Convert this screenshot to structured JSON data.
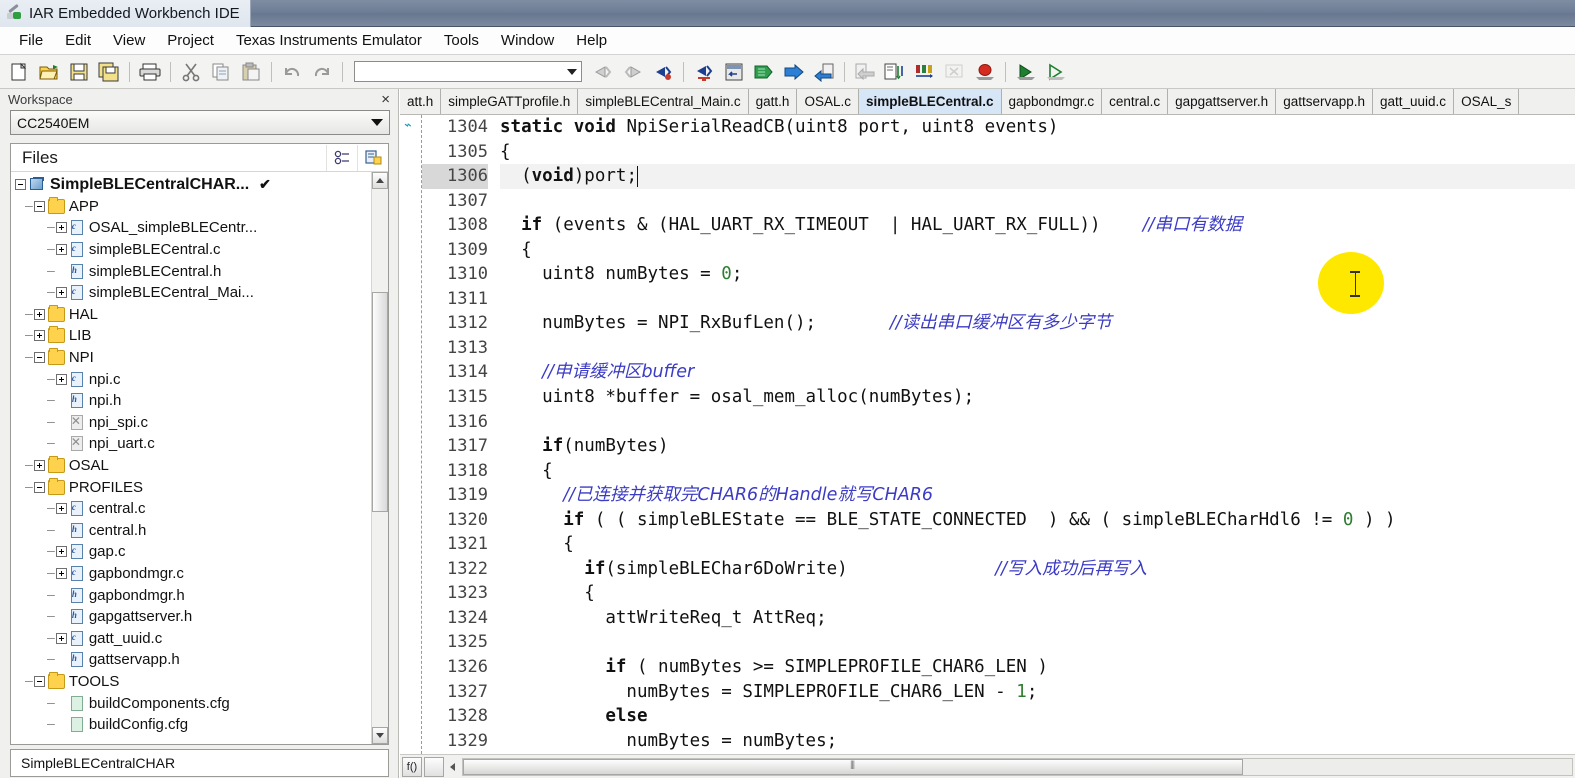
{
  "window": {
    "title": "IAR Embedded Workbench IDE",
    "app_icon": "iar-logo-icon"
  },
  "menubar": {
    "items": [
      "File",
      "Edit",
      "View",
      "Project",
      "Texas Instruments Emulator",
      "Tools",
      "Window",
      "Help"
    ]
  },
  "toolbar": {
    "combo_value": "",
    "buttons": [
      {
        "name": "new-document-icon"
      },
      {
        "name": "open-folder-icon"
      },
      {
        "name": "save-icon"
      },
      {
        "name": "save-all-icon"
      },
      {
        "name": "print-icon"
      },
      {
        "name": "cut-icon"
      },
      {
        "name": "copy-icon"
      },
      {
        "name": "paste-icon"
      },
      {
        "name": "undo-icon"
      },
      {
        "name": "redo-icon"
      },
      {
        "name": "find-previous-icon"
      },
      {
        "name": "find-next-icon"
      },
      {
        "name": "bookmark-toggle-icon"
      },
      {
        "name": "bookmark-goto-icon"
      },
      {
        "name": "navigate-back-icon"
      },
      {
        "name": "make-icon"
      },
      {
        "name": "compile-icon"
      },
      {
        "name": "debug-download-icon"
      },
      {
        "name": "stop-build-icon"
      },
      {
        "name": "next-statement-icon"
      },
      {
        "name": "step-over-icon"
      },
      {
        "name": "step-into-icon"
      },
      {
        "name": "toggle-breakpoint-icon"
      },
      {
        "name": "go-icon"
      },
      {
        "name": "debug-without-download-icon"
      }
    ]
  },
  "workspace": {
    "panel_title": "Workspace",
    "close_label": "×",
    "config_value": "CC2540EM",
    "files_header": "Files",
    "header_buttons": [
      "sort-icon",
      "add-group-icon"
    ],
    "bottom_tab": "SimpleBLECentralCHAR",
    "tree": [
      {
        "label": "SimpleBLECentralCHAR...",
        "depth": 0,
        "toggle": "minus",
        "icon": "workspace-icon",
        "root": true,
        "check": "✔"
      },
      {
        "label": "APP",
        "depth": 1,
        "toggle": "minus",
        "icon": "folder"
      },
      {
        "label": "OSAL_simpleBLECentr...",
        "depth": 2,
        "toggle": "plus",
        "icon": "c-file"
      },
      {
        "label": "simpleBLECentral.c",
        "depth": 2,
        "toggle": "plus",
        "icon": "c-file"
      },
      {
        "label": "simpleBLECentral.h",
        "depth": 2,
        "toggle": "none",
        "icon": "h-file"
      },
      {
        "label": "simpleBLECentral_Mai...",
        "depth": 2,
        "toggle": "plus",
        "icon": "c-file"
      },
      {
        "label": "HAL",
        "depth": 1,
        "toggle": "plus",
        "icon": "folder"
      },
      {
        "label": "LIB",
        "depth": 1,
        "toggle": "plus",
        "icon": "folder"
      },
      {
        "label": "NPI",
        "depth": 1,
        "toggle": "minus",
        "icon": "folder"
      },
      {
        "label": "npi.c",
        "depth": 2,
        "toggle": "plus",
        "icon": "c-file"
      },
      {
        "label": "npi.h",
        "depth": 2,
        "toggle": "none",
        "icon": "h-file"
      },
      {
        "label": "npi_spi.c",
        "depth": 2,
        "toggle": "none",
        "icon": "excluded-file"
      },
      {
        "label": "npi_uart.c",
        "depth": 2,
        "toggle": "none",
        "icon": "excluded-file"
      },
      {
        "label": "OSAL",
        "depth": 1,
        "toggle": "plus",
        "icon": "folder"
      },
      {
        "label": "PROFILES",
        "depth": 1,
        "toggle": "minus",
        "icon": "folder"
      },
      {
        "label": "central.c",
        "depth": 2,
        "toggle": "plus",
        "icon": "c-file"
      },
      {
        "label": "central.h",
        "depth": 2,
        "toggle": "none",
        "icon": "h-file"
      },
      {
        "label": "gap.c",
        "depth": 2,
        "toggle": "plus",
        "icon": "c-file"
      },
      {
        "label": "gapbondmgr.c",
        "depth": 2,
        "toggle": "plus",
        "icon": "c-file"
      },
      {
        "label": "gapbondmgr.h",
        "depth": 2,
        "toggle": "none",
        "icon": "h-file"
      },
      {
        "label": "gapgattserver.h",
        "depth": 2,
        "toggle": "none",
        "icon": "h-file"
      },
      {
        "label": "gatt_uuid.c",
        "depth": 2,
        "toggle": "plus",
        "icon": "c-file"
      },
      {
        "label": "gattservapp.h",
        "depth": 2,
        "toggle": "none",
        "icon": "h-file"
      },
      {
        "label": "TOOLS",
        "depth": 1,
        "toggle": "minus",
        "icon": "folder"
      },
      {
        "label": "buildComponents.cfg",
        "depth": 2,
        "toggle": "none",
        "icon": "cfg-file"
      },
      {
        "label": "buildConfig.cfg",
        "depth": 2,
        "toggle": "none",
        "icon": "cfg-file"
      }
    ]
  },
  "editor": {
    "tabs": [
      {
        "label": "att.h",
        "active": false
      },
      {
        "label": "simpleGATTprofile.h",
        "active": false
      },
      {
        "label": "simpleBLECentral_Main.c",
        "active": false
      },
      {
        "label": "gatt.h",
        "active": false
      },
      {
        "label": "OSAL.c",
        "active": false
      },
      {
        "label": "simpleBLECentral.c",
        "active": true
      },
      {
        "label": "gapbondmgr.c",
        "active": false
      },
      {
        "label": "central.c",
        "active": false
      },
      {
        "label": "gapgattserver.h",
        "active": false
      },
      {
        "label": "gattservapp.h",
        "active": false
      },
      {
        "label": "gatt_uuid.c",
        "active": false
      },
      {
        "label": "OSAL_s",
        "active": false
      }
    ],
    "first_line_number": 1304,
    "current_line": 1306,
    "lines": [
      {
        "n": 1304,
        "segs": [
          {
            "t": "static void",
            "c": "kw"
          },
          {
            "t": " NpiSerialReadCB(uint8 port, uint8 events)",
            "c": ""
          }
        ]
      },
      {
        "n": 1305,
        "segs": [
          {
            "t": "{",
            "c": ""
          }
        ]
      },
      {
        "n": 1306,
        "segs": [
          {
            "t": "  (",
            "c": ""
          },
          {
            "t": "void",
            "c": "kw"
          },
          {
            "t": ")port;",
            "c": ""
          }
        ]
      },
      {
        "n": 1307,
        "segs": []
      },
      {
        "n": 1308,
        "segs": [
          {
            "t": "  ",
            "c": ""
          },
          {
            "t": "if",
            "c": "kw"
          },
          {
            "t": " (events & (HAL_UART_RX_TIMEOUT  | HAL_UART_RX_FULL))    ",
            "c": ""
          },
          {
            "t": "//串口有数据",
            "c": "cmt-cn"
          }
        ]
      },
      {
        "n": 1309,
        "segs": [
          {
            "t": "  {",
            "c": ""
          }
        ]
      },
      {
        "n": 1310,
        "segs": [
          {
            "t": "    uint8 numBytes = ",
            "c": ""
          },
          {
            "t": "0",
            "c": "num"
          },
          {
            "t": ";",
            "c": ""
          }
        ]
      },
      {
        "n": 1311,
        "segs": []
      },
      {
        "n": 1312,
        "segs": [
          {
            "t": "    numBytes = NPI_RxBufLen();       ",
            "c": ""
          },
          {
            "t": "//读出串口缓冲区有多少字节",
            "c": "cmt-cn"
          }
        ]
      },
      {
        "n": 1313,
        "segs": []
      },
      {
        "n": 1314,
        "segs": [
          {
            "t": "    ",
            "c": ""
          },
          {
            "t": "//申请缓冲区buffer",
            "c": "cmt-cn"
          }
        ]
      },
      {
        "n": 1315,
        "segs": [
          {
            "t": "    uint8 *buffer = osal_mem_alloc(numBytes);",
            "c": ""
          }
        ]
      },
      {
        "n": 1316,
        "segs": []
      },
      {
        "n": 1317,
        "segs": [
          {
            "t": "    ",
            "c": ""
          },
          {
            "t": "if",
            "c": "kw"
          },
          {
            "t": "(numBytes)",
            "c": ""
          }
        ]
      },
      {
        "n": 1318,
        "segs": [
          {
            "t": "    {",
            "c": ""
          }
        ]
      },
      {
        "n": 1319,
        "segs": [
          {
            "t": "      ",
            "c": ""
          },
          {
            "t": "//已连接并获取完CHAR6的Handle就写CHAR6",
            "c": "cmt-cn"
          }
        ]
      },
      {
        "n": 1320,
        "segs": [
          {
            "t": "      ",
            "c": ""
          },
          {
            "t": "if",
            "c": "kw"
          },
          {
            "t": " ( ( simpleBLEState == BLE_STATE_CONNECTED  ) && ( simpleBLECharHdl6 != ",
            "c": ""
          },
          {
            "t": "0",
            "c": "num"
          },
          {
            "t": " ) )",
            "c": ""
          }
        ]
      },
      {
        "n": 1321,
        "segs": [
          {
            "t": "      {",
            "c": ""
          }
        ]
      },
      {
        "n": 1322,
        "segs": [
          {
            "t": "        ",
            "c": ""
          },
          {
            "t": "if",
            "c": "kw"
          },
          {
            "t": "(simpleBLEChar6DoWrite)              ",
            "c": ""
          },
          {
            "t": "//写入成功后再写入",
            "c": "cmt-cn"
          }
        ]
      },
      {
        "n": 1323,
        "segs": [
          {
            "t": "        {",
            "c": ""
          }
        ]
      },
      {
        "n": 1324,
        "segs": [
          {
            "t": "          attWriteReq_t AttReq;",
            "c": ""
          }
        ]
      },
      {
        "n": 1325,
        "segs": []
      },
      {
        "n": 1326,
        "segs": [
          {
            "t": "          ",
            "c": ""
          },
          {
            "t": "if",
            "c": "kw"
          },
          {
            "t": " ( numBytes >= SIMPLEPROFILE_CHAR6_LEN )",
            "c": ""
          }
        ]
      },
      {
        "n": 1327,
        "segs": [
          {
            "t": "            numBytes = SIMPLEPROFILE_CHAR6_LEN - ",
            "c": ""
          },
          {
            "t": "1",
            "c": "num"
          },
          {
            "t": ";",
            "c": ""
          }
        ]
      },
      {
        "n": 1328,
        "segs": [
          {
            "t": "          ",
            "c": ""
          },
          {
            "t": "else",
            "c": "kw"
          }
        ]
      },
      {
        "n": 1329,
        "segs": [
          {
            "t": "            numBytes = numBytes;",
            "c": ""
          }
        ]
      }
    ],
    "hscroll_left_button": "f()",
    "hscroll_grip": "⦀"
  },
  "colors": {
    "titlebar_accent": "#6d7d95",
    "active_tab": "#d6e6f7",
    "comment": "#3b3bc4",
    "number": "#2f7d32",
    "current_line": "#d8d8d8",
    "cursor_highlight": "#ffe800",
    "folder": "#ffd24d"
  }
}
